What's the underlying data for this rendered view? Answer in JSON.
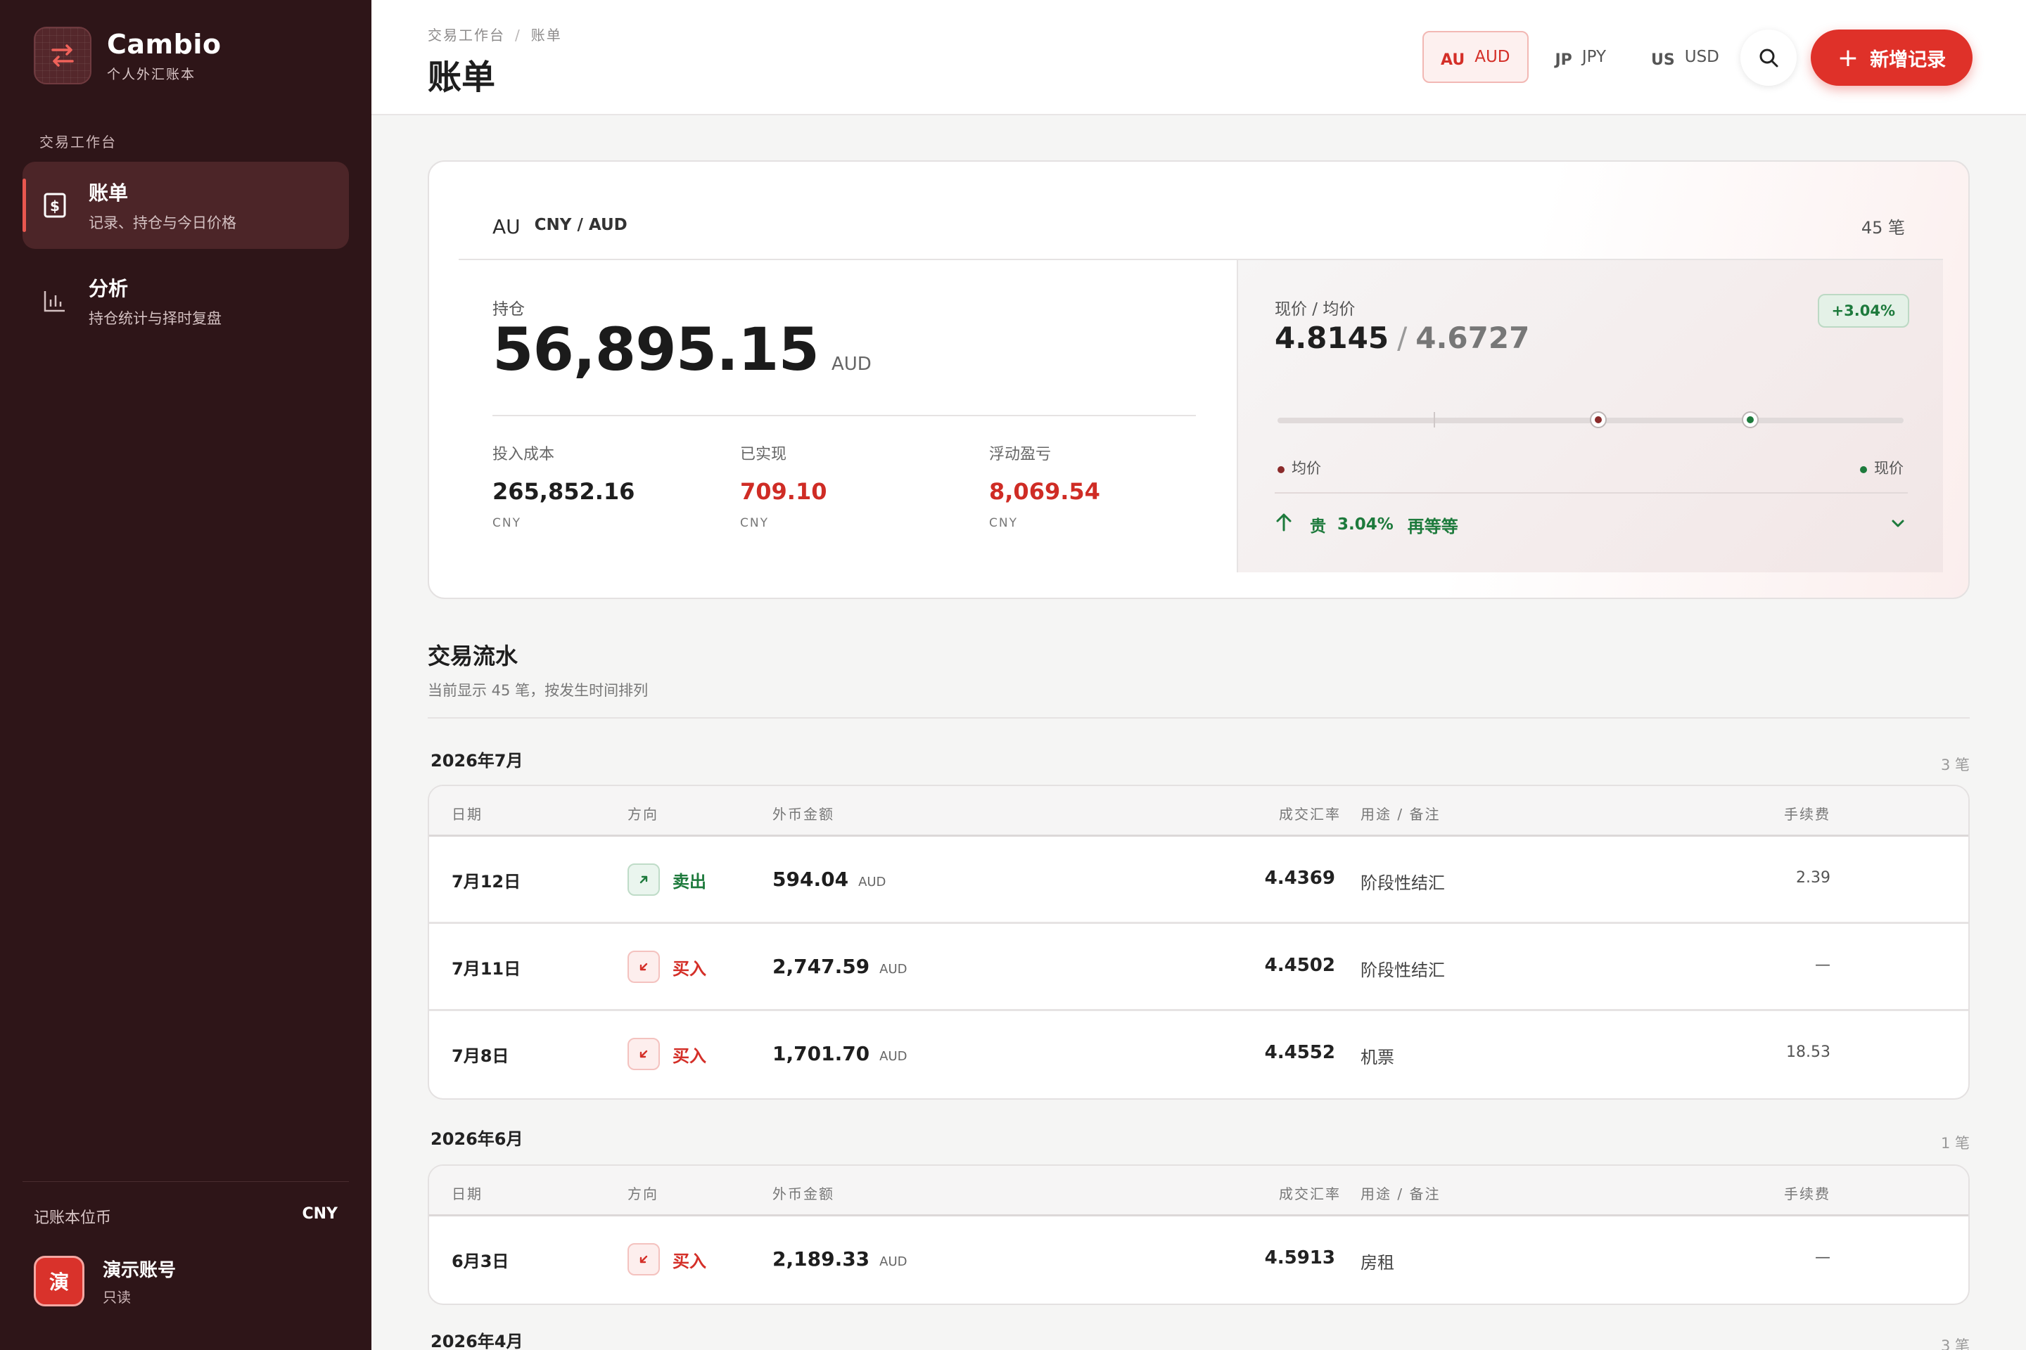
{
  "sidebar": {
    "brand_name": "Cambio",
    "brand_sub": "个人外汇账本",
    "section_label": "交易工作台",
    "items": [
      {
        "title": "账单",
        "desc": "记录、持仓与今日价格",
        "active": true,
        "icon": "receipt-icon"
      },
      {
        "title": "分析",
        "desc": "持仓统计与择时复盘",
        "active": false,
        "icon": "bar-chart-icon"
      }
    ],
    "base_currency_label": "记账本位币",
    "base_currency_value": "CNY",
    "account_avatar": "演",
    "account_name": "演示账号",
    "account_role": "只读"
  },
  "header": {
    "breadcrumb": [
      "交易工作台",
      "账单"
    ],
    "breadcrumb_sep": "/",
    "title": "账单",
    "currency_tabs": [
      {
        "code": "AU",
        "label": "AUD",
        "active": true
      },
      {
        "code": "JP",
        "label": "JPY",
        "active": false
      },
      {
        "code": "US",
        "label": "USD",
        "active": false
      }
    ],
    "add_button_label": "新增记录",
    "add_button_plus": "+"
  },
  "summary": {
    "pair_flag": "AU",
    "pair": "CNY / AUD",
    "record_count": "45 笔",
    "holding_label": "持仓",
    "holding_value": "56,895.15",
    "holding_unit": "AUD",
    "metrics": [
      {
        "label": "投入成本",
        "value": "265,852.16",
        "unit": "CNY",
        "highlight": false
      },
      {
        "label": "已实现",
        "value": "709.10",
        "unit": "CNY",
        "highlight": true
      },
      {
        "label": "浮动盈亏",
        "value": "8,069.54",
        "unit": "CNY",
        "highlight": true
      }
    ],
    "price_label": "现价 / 均价",
    "current_price": "4.8145",
    "price_sep": "/",
    "avg_price": "4.6727",
    "change_badge": "+3.04%",
    "legend_avg": "均价",
    "legend_current": "现价",
    "signal_tag": "贵",
    "signal_pct": "3.04%",
    "signal_action": "再等等",
    "colors": {
      "avg": "#8a2a2a",
      "current": "#1d7a3c",
      "accent": "#df3129"
    }
  },
  "transactions": {
    "title": "交易流水",
    "subtitle": "当前显示 45 笔，按发生时间排列",
    "columns": {
      "date": "日期",
      "direction": "方向",
      "amount": "外币金额",
      "rate": "成交汇率",
      "note": "用途 / 备注",
      "fee": "手续费"
    },
    "groups": [
      {
        "month": "2026年7月",
        "count": "3 笔",
        "rows": [
          {
            "date": "7月12日",
            "direction": "卖出",
            "type": "sell",
            "amount": "594.04",
            "unit": "AUD",
            "rate": "4.4369",
            "note": "阶段性结汇",
            "fee": "2.39"
          },
          {
            "date": "7月11日",
            "direction": "买入",
            "type": "buy",
            "amount": "2,747.59",
            "unit": "AUD",
            "rate": "4.4502",
            "note": "阶段性结汇",
            "fee": "—"
          },
          {
            "date": "7月8日",
            "direction": "买入",
            "type": "buy",
            "amount": "1,701.70",
            "unit": "AUD",
            "rate": "4.4552",
            "note": "机票",
            "fee": "18.53"
          }
        ]
      },
      {
        "month": "2026年6月",
        "count": "1 笔",
        "rows": [
          {
            "date": "6月3日",
            "direction": "买入",
            "type": "buy",
            "amount": "2,189.33",
            "unit": "AUD",
            "rate": "4.5913",
            "note": "房租",
            "fee": "—"
          }
        ]
      },
      {
        "month": "2026年4月",
        "count": "3 笔",
        "rows": []
      }
    ]
  }
}
